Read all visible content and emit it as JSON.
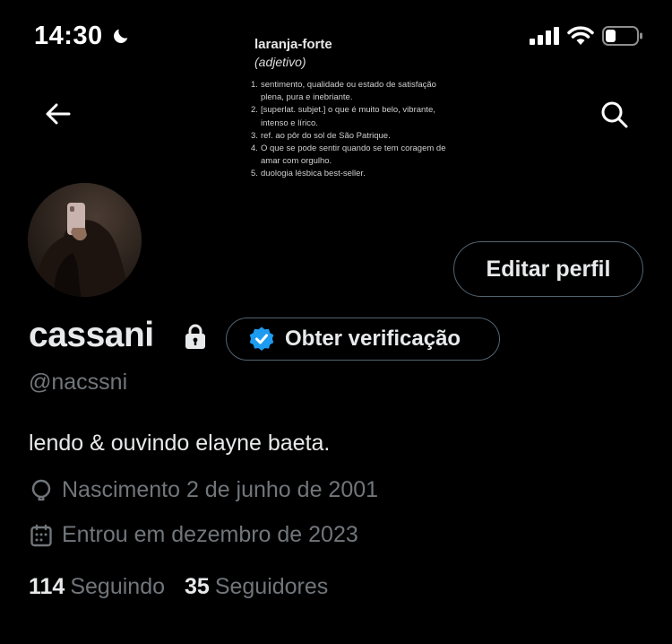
{
  "status_bar": {
    "time": "14:30",
    "icons": [
      "moon-icon",
      "signal-icon",
      "wifi-icon",
      "battery-icon"
    ]
  },
  "banner": {
    "word": "laranja-forte",
    "word_class": "(adjetivo)",
    "definitions": [
      {
        "num": "1.",
        "text": "sentimento, qualidade ou estado de satisfação plena, pura e inebriante."
      },
      {
        "num": "2.",
        "text": "[superlat. subjet.] o que é muito belo, vibrante, intenso e lírico."
      },
      {
        "num": "3.",
        "text": "ref. ao pôr do sol de São Patrique."
      },
      {
        "num": "4.",
        "text": "O que se pode sentir quando se tem coragem de amar com orgulho."
      },
      {
        "num": "5.",
        "text": "duologia lésbica best-seller."
      }
    ]
  },
  "header": {
    "back_icon": "arrow-left-icon",
    "search_icon": "search-icon"
  },
  "profile": {
    "edit_label": "Editar perfil",
    "name": "cassani",
    "verify_label": "Obter verificação",
    "handle": "@nacssni",
    "bio": "lendo & ouvindo elayne baeta.",
    "birth": "Nascimento 2 de junho de 2001",
    "joined": "Entrou em dezembro de 2023",
    "following_count": "114",
    "following_label": "Seguindo",
    "followers_count": "35",
    "followers_label": "Seguidores"
  },
  "colors": {
    "background": "#000000",
    "text": "#e7e9ea",
    "secondary": "#71767b",
    "border": "#536471",
    "verify_blue": "#1d9bf0"
  }
}
